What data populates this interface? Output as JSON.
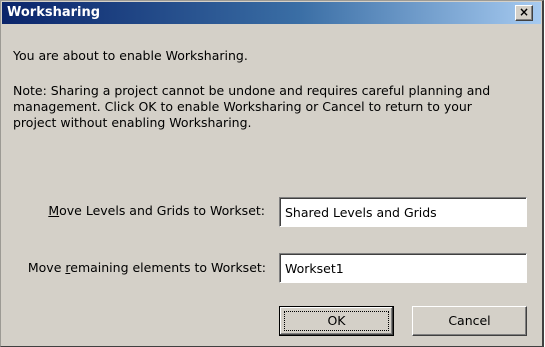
{
  "window": {
    "title": "Worksharing",
    "close_glyph": "×"
  },
  "message": {
    "intro": "You are about to enable Worksharing.",
    "note": "Note: Sharing a project cannot be undone and requires careful planning and management.  Click OK to enable Worksharing or Cancel to return to your project without enabling Worksharing."
  },
  "form": {
    "levels_label_mnemonic": "M",
    "levels_label_rest": "ove Levels and Grids to Workset:",
    "levels_value": "Shared Levels and Grids",
    "remaining_label_pre": "Move ",
    "remaining_label_mnemonic": "r",
    "remaining_label_rest": "emaining elements to Workset:",
    "remaining_value": "Workset1"
  },
  "buttons": {
    "ok_label": "OK",
    "cancel_label": "Cancel"
  }
}
